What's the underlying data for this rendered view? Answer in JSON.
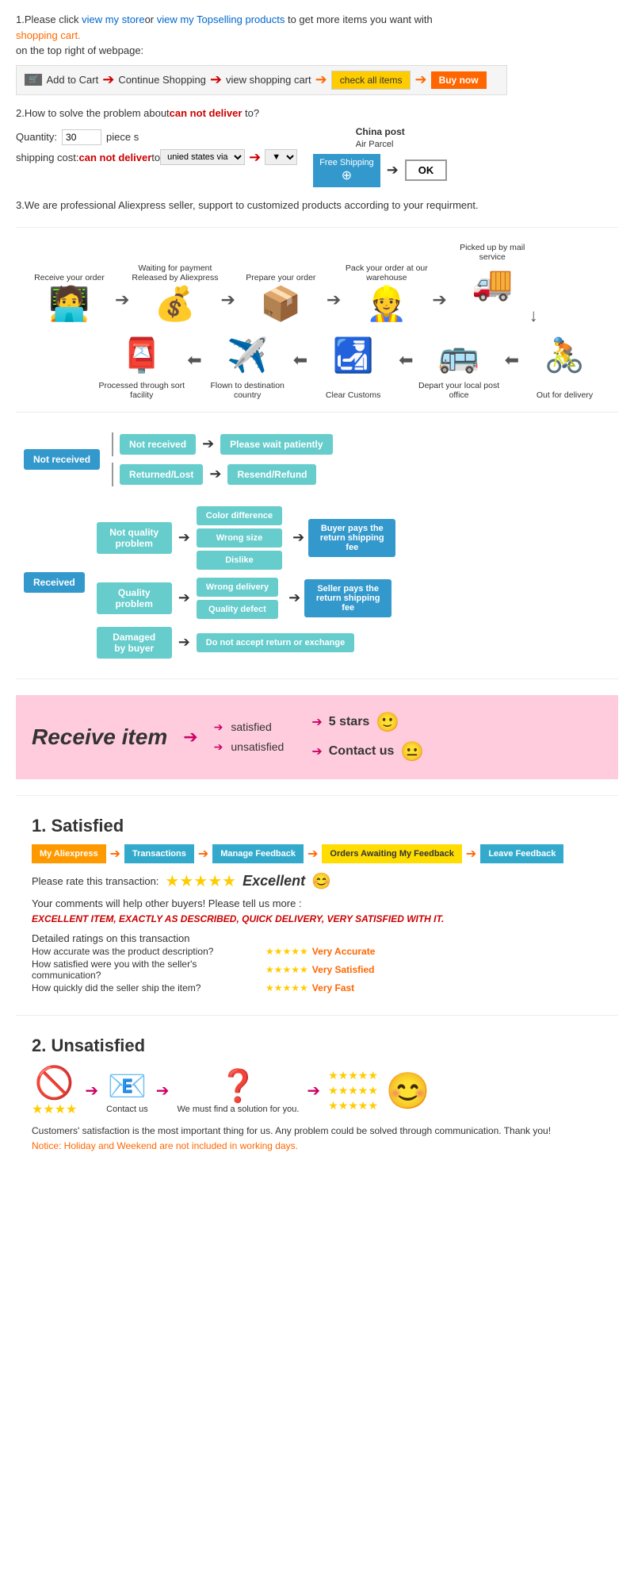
{
  "section1": {
    "text1": "1.Please click ",
    "link1": "view my store",
    "text2": "or ",
    "link2": "view my Topselling products",
    "text3": " to get more items you want with",
    "text4": "shopping cart.",
    "text5": "on the top right of webpage:",
    "steps": {
      "addtocart": "Add to Cart",
      "continue": "Continue Shopping",
      "view": "view shopping cart",
      "check": "check all items",
      "buynow": "Buy now"
    }
  },
  "section2": {
    "title": "2.How to solve the problem about",
    "cannotdeliver": "can not deliver",
    "title2": " to?",
    "quantity_label": "Quantity:",
    "quantity_value": "30",
    "piece": "piece s",
    "shipping_label": "shipping cost:",
    "cannot_deliver": "can not deliver",
    "to": " to ",
    "select_val": "unied states via",
    "china_post": "China post",
    "air_parcel": "Air Parcel",
    "free_shipping": "Free Shipping",
    "ok": "OK"
  },
  "section3": {
    "text": "3.We are professional Aliexpress seller, support to customized products according to your requirment."
  },
  "process": {
    "top_labels": [
      "Receive your order",
      "Waiting for payment Released by Aliexpress",
      "Prepare your order",
      "Pack your order at our warehouse",
      "Picked up by mail service"
    ],
    "top_icons": [
      "🧑‍💻",
      "💰",
      "📦",
      "👷",
      "🚚"
    ],
    "bottom_labels": [
      "Out for delivery",
      "Depart your local post office",
      "Clear Customs",
      "Flown to destination country",
      "Processed through sort facility"
    ],
    "bottom_icons": [
      "🚴",
      "🚌",
      "🛃",
      "✈️",
      "📮"
    ]
  },
  "flowchart": {
    "not_received": "Not received",
    "not_received_node": "Not received",
    "returned_lost": "Returned/Lost",
    "please_wait": "Please wait patiently",
    "resend_refund": "Resend/Refund",
    "received": "Received",
    "not_quality": "Not quality problem",
    "quality": "Quality problem",
    "damaged": "Damaged by buyer",
    "color_diff": "Color difference",
    "wrong_size": "Wrong size",
    "dislike": "Dislike",
    "wrong_delivery": "Wrong delivery",
    "quality_defect": "Quality defect",
    "buyer_pays": "Buyer pays the return shipping fee",
    "seller_pays": "Seller pays the return shipping fee",
    "do_not_accept": "Do not accept return or exchange"
  },
  "receive_item": {
    "title": "Receive item",
    "satisfied": "satisfied",
    "unsatisfied": "unsatisfied",
    "five_stars": "5 stars",
    "contact_us": "Contact us",
    "emoji_happy": "🙂",
    "emoji_neutral": "😐"
  },
  "satisfied": {
    "title": "1. Satisfied",
    "steps": [
      "My Aliexpress",
      "Transactions",
      "Manage Feedback",
      "Orders Awaiting My Feedback",
      "Leave Feedback"
    ],
    "rate_text": "Please rate this transaction:",
    "excellent": "Excellent",
    "emoji": "😊",
    "comment": "Your comments will help other buyers! Please tell us more :",
    "excellent_item": "EXCELLENT ITEM, EXACTLY AS DESCRIBED, QUICK DELIVERY, VERY SATISFIED WITH IT.",
    "detailed": "Detailed ratings on this transaction",
    "q1": "How accurate was the product description?",
    "q2": "How satisfied were you with the seller's communication?",
    "q3": "How quickly did the seller ship the item?",
    "a1": "Very Accurate",
    "a2": "Very Satisfied",
    "a3": "Very Fast"
  },
  "unsatisfied": {
    "title": "2. Unsatisfied",
    "icons": [
      "🚫",
      "📧",
      "❓",
      "⭐"
    ],
    "contact_us": "Contact us",
    "must_find": "We must find a solution for you.",
    "customer_text": "Customers' satisfaction is the most important thing for us. Any problem could be solved through communication. Thank you!",
    "notice": "Notice: Holiday and Weekend are not included in working days."
  }
}
